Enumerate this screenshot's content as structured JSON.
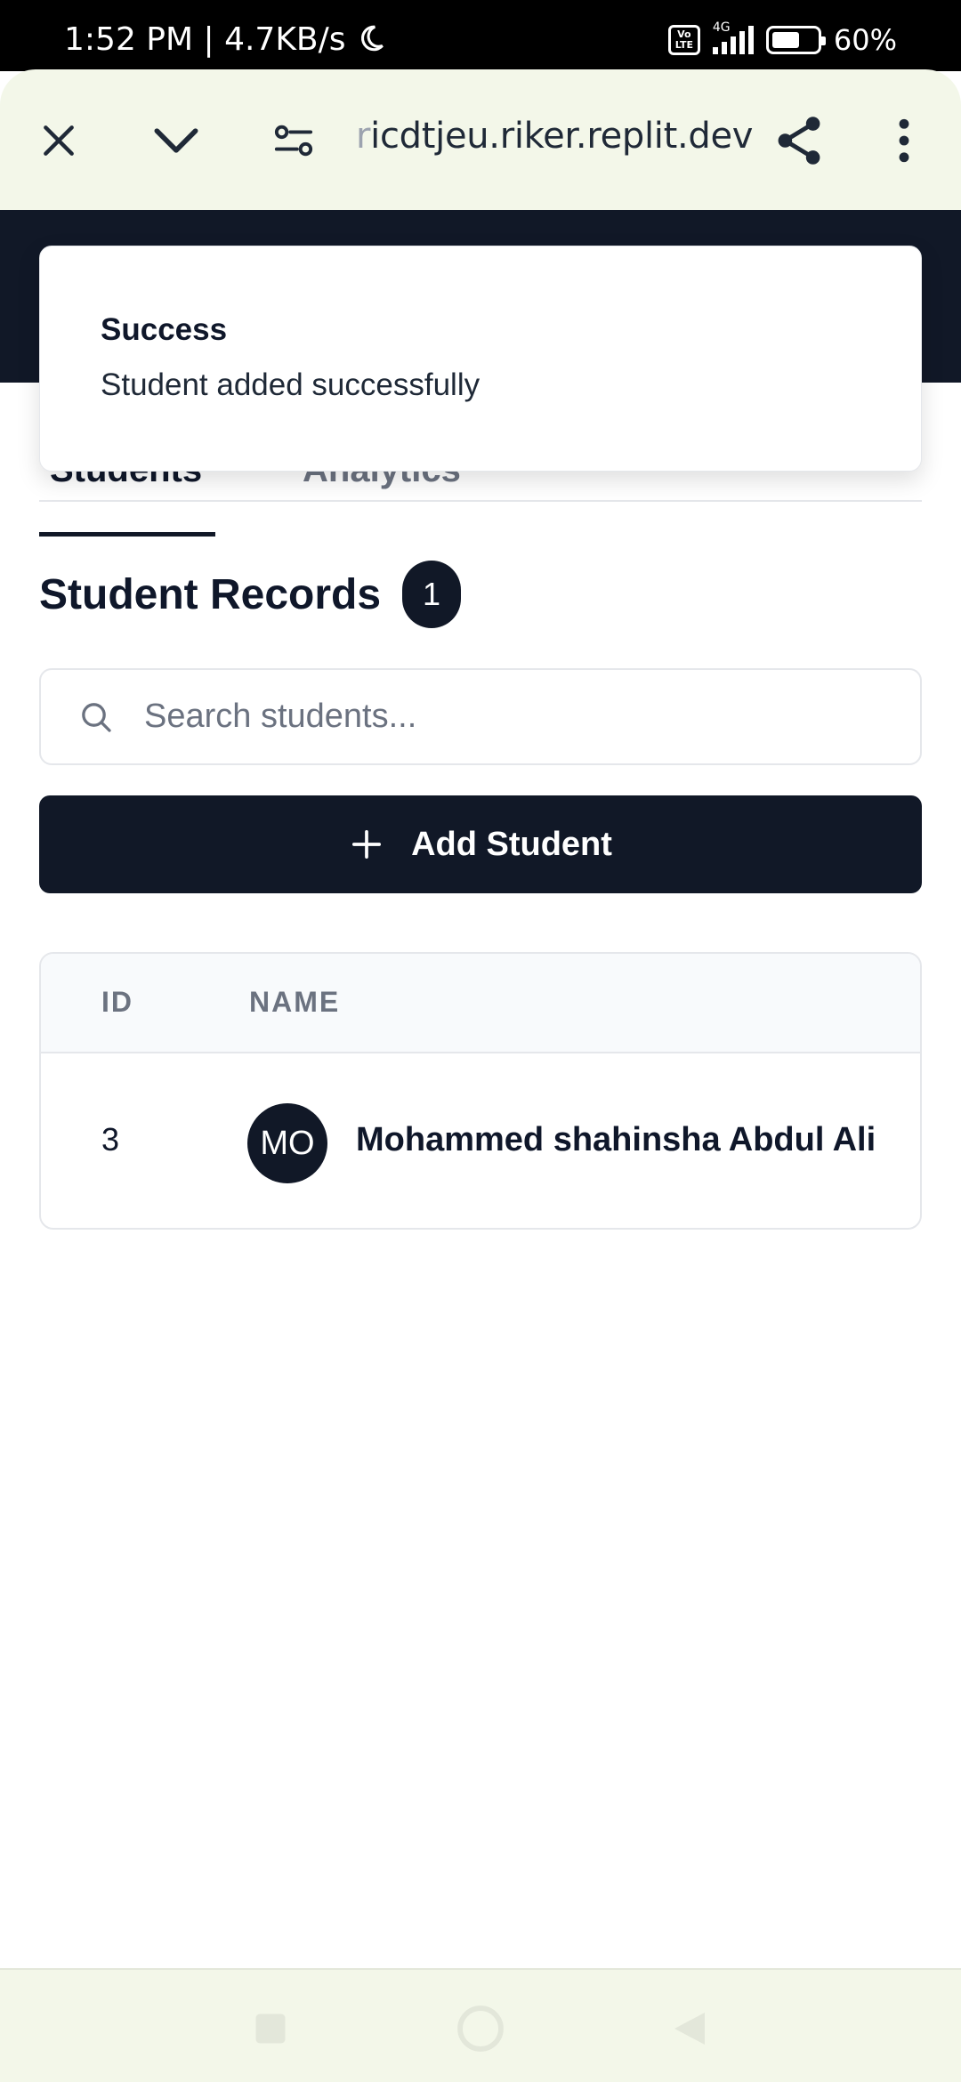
{
  "status_bar": {
    "time_speed": "1:52 PM | 4.7KB/s",
    "volte": "Vo LTE",
    "network": "4G",
    "battery": "60%",
    "battery_level": 0.6
  },
  "browser": {
    "url_fade": "r",
    "url": "icdtjeu.riker.replit.dev"
  },
  "toast": {
    "title": "Success",
    "message": "Student added successfully"
  },
  "tabs": [
    {
      "label": "Students",
      "active": true
    },
    {
      "label": "Analytics",
      "active": false
    }
  ],
  "heading": {
    "title": "Student Records",
    "count": "1"
  },
  "search": {
    "placeholder": "Search students..."
  },
  "add_button": {
    "label": "Add Student"
  },
  "table": {
    "columns": [
      "ID",
      "NAME"
    ],
    "rows": [
      {
        "id": "3",
        "initials": "MO",
        "name": "Mohammed shahinsha Abdul Ali"
      }
    ]
  },
  "colors": {
    "primary": "#111827",
    "browser_bar": "#f3f7e9"
  }
}
